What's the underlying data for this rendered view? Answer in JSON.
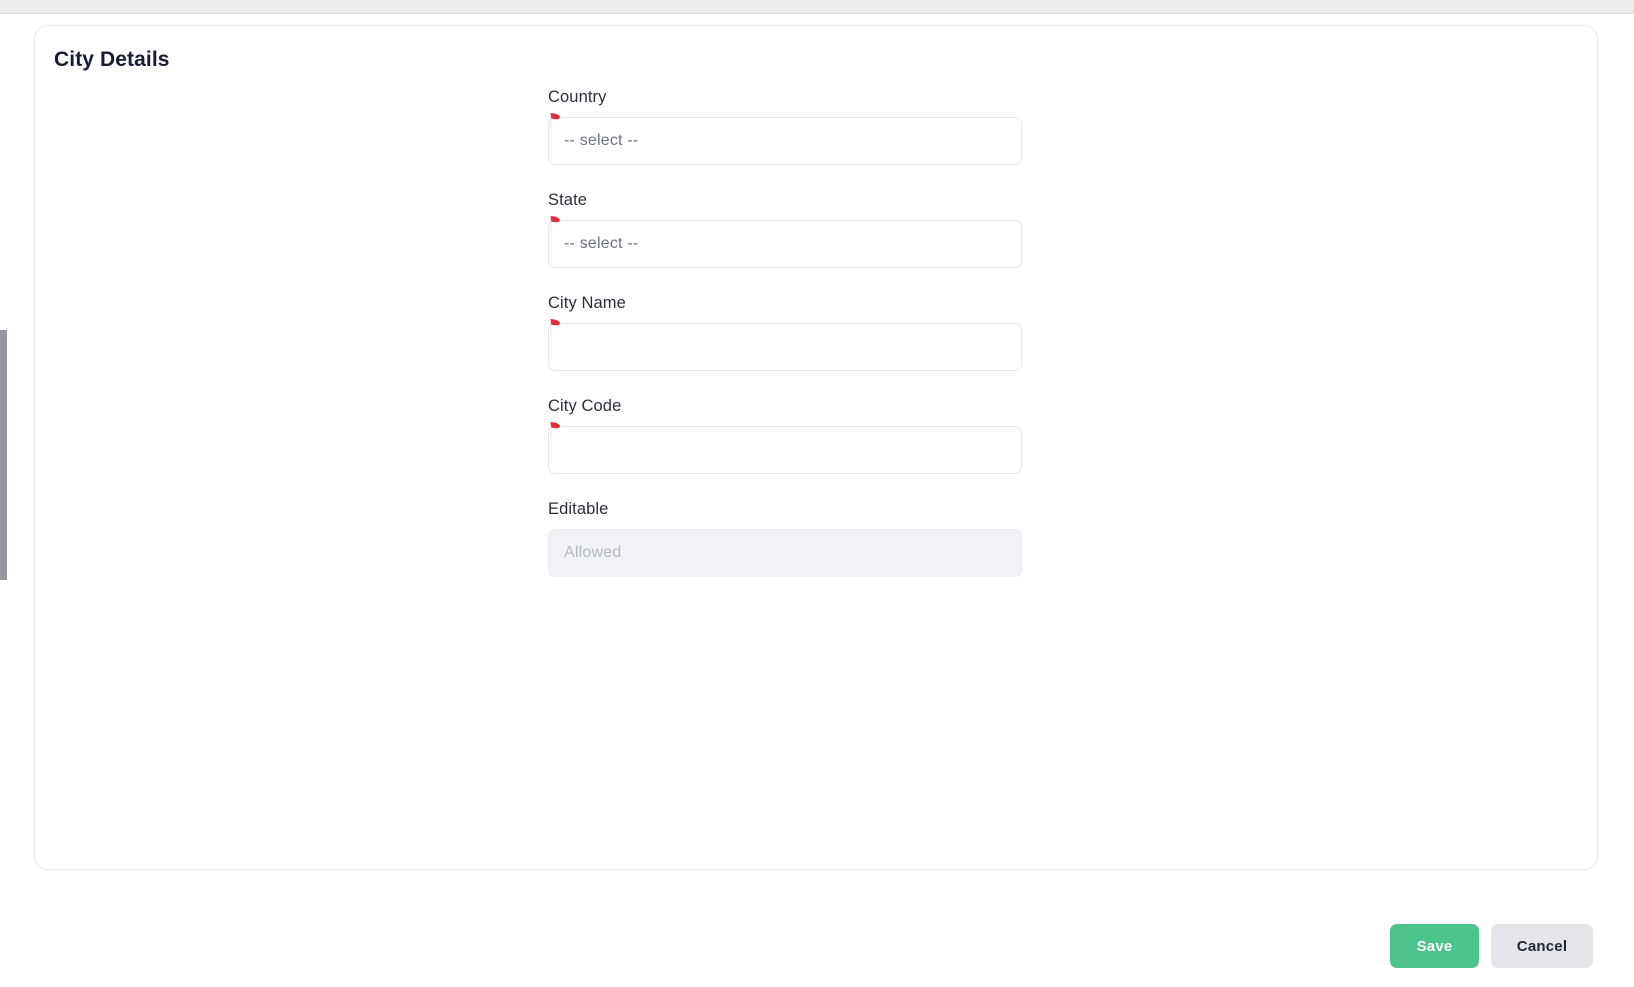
{
  "window": {
    "accent_green": "#4CC38A",
    "required_marker_color": "#E12D39",
    "card_background": "#FFFFFF",
    "page_background": "#FFFFFF"
  },
  "card": {
    "title": "City Details"
  },
  "form": {
    "fields": [
      {
        "label": "Country",
        "type": "select",
        "value": "",
        "placeholder": "-- select --",
        "required": true,
        "disabled": false
      },
      {
        "label": "State",
        "type": "select",
        "value": "",
        "placeholder": "-- select --",
        "required": true,
        "disabled": false
      },
      {
        "label": "City Name",
        "type": "text",
        "value": "",
        "placeholder": "",
        "required": true,
        "disabled": false
      },
      {
        "label": "City Code",
        "type": "text",
        "value": "",
        "placeholder": "",
        "required": true,
        "disabled": false
      },
      {
        "label": "Editable",
        "type": "text",
        "value": "",
        "placeholder": "Allowed",
        "required": false,
        "disabled": true
      }
    ]
  },
  "footer": {
    "save_label": "Save",
    "cancel_label": "Cancel"
  }
}
